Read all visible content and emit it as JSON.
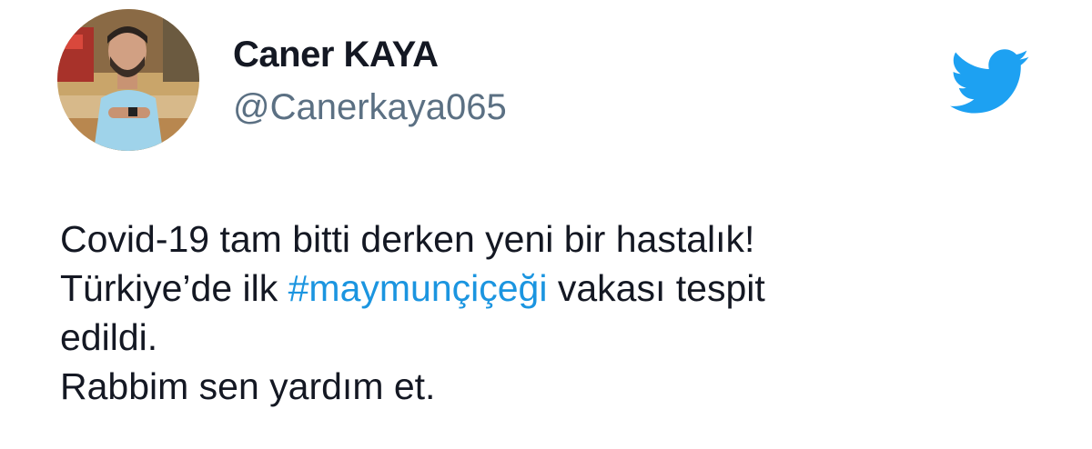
{
  "author": {
    "display_name": "Caner KAYA",
    "handle": "@Canerkaya065"
  },
  "brand": {
    "icon": "twitter-bird-icon",
    "color": "#1da1f2"
  },
  "tweet": {
    "line1": "Covid-19 tam bitti derken yeni bir hastalık!",
    "line2_before": "Türkiye’de ilk ",
    "hashtag": "#maymunçiçeği",
    "line2_after": " vakası tespit",
    "line3": "edildi.",
    "line4": "Rabbim sen yardım et."
  },
  "colors": {
    "text": "#141823",
    "handle": "#5b7083",
    "hashtag": "#1b95e0"
  }
}
